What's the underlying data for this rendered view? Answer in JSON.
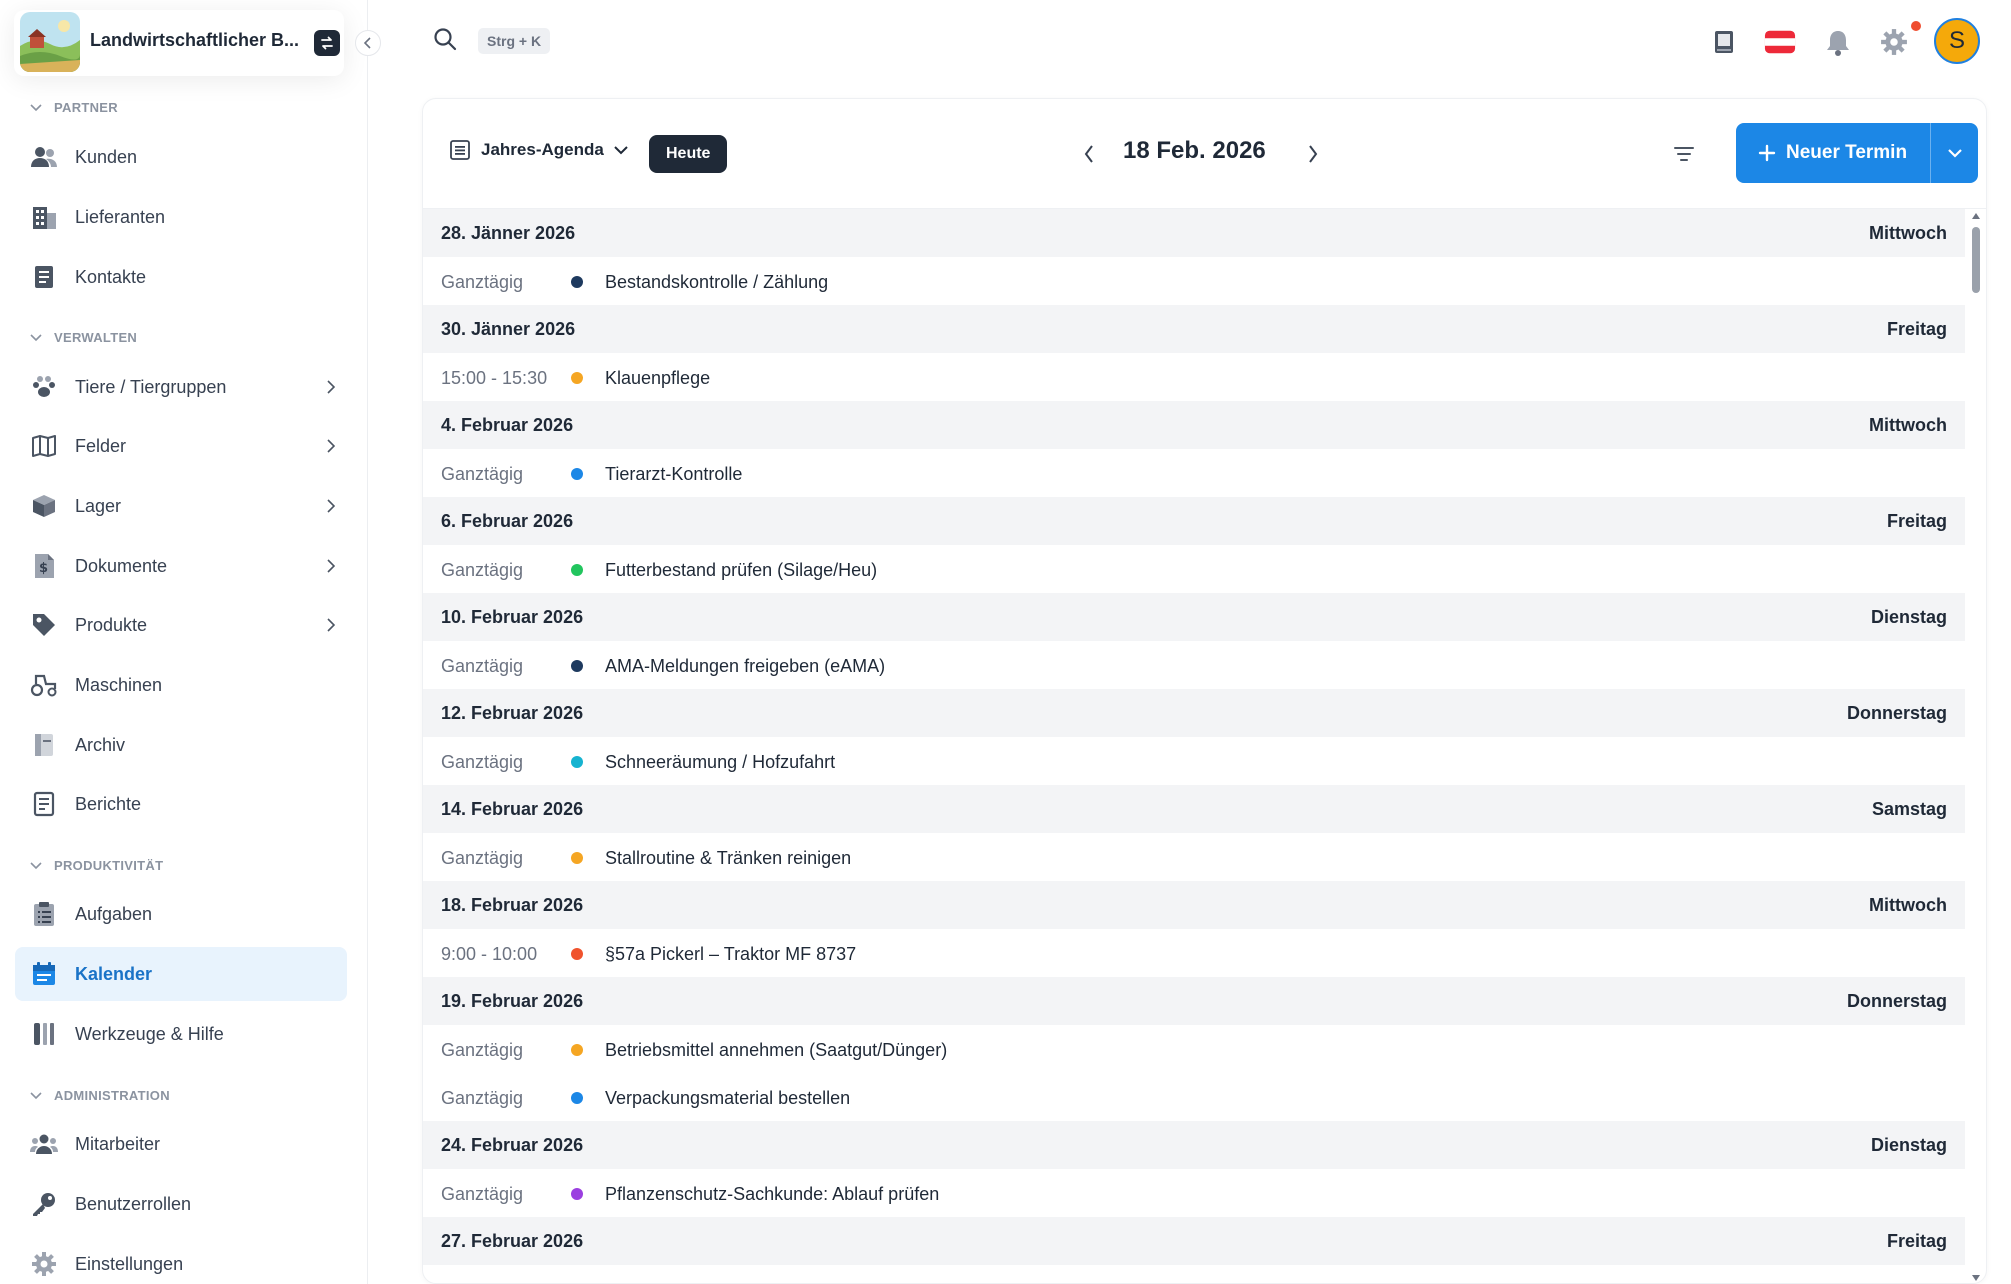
{
  "brand": {
    "name": "Landwirtschaftlicher B..."
  },
  "search": {
    "shortcut": "Strg + K"
  },
  "user": {
    "initial": "S"
  },
  "sidebar": {
    "sections": [
      {
        "title": "PARTNER"
      },
      {
        "title": "VERWALTEN"
      },
      {
        "title": "PRODUKTIVITÄT"
      },
      {
        "title": "ADMINISTRATION"
      }
    ],
    "items": [
      {
        "label": "Kunden",
        "icon": "users-icon"
      },
      {
        "label": "Lieferanten",
        "icon": "building-icon"
      },
      {
        "label": "Kontakte",
        "icon": "contact-card-icon"
      },
      {
        "label": "Tiere / Tiergruppen",
        "icon": "paw-icon"
      },
      {
        "label": "Felder",
        "icon": "map-icon"
      },
      {
        "label": "Lager",
        "icon": "box-icon"
      },
      {
        "label": "Dokumente",
        "icon": "dollar-document-icon"
      },
      {
        "label": "Produkte",
        "icon": "tag-icon"
      },
      {
        "label": "Maschinen",
        "icon": "tractor-icon"
      },
      {
        "label": "Archiv",
        "icon": "archive-icon"
      },
      {
        "label": "Berichte",
        "icon": "report-icon"
      },
      {
        "label": "Aufgaben",
        "icon": "clipboard-list-icon"
      },
      {
        "label": "Kalender",
        "icon": "calendar-icon"
      },
      {
        "label": "Werkzeuge & Hilfe",
        "icon": "tools-icon"
      },
      {
        "label": "Mitarbeiter",
        "icon": "team-icon"
      },
      {
        "label": "Benutzerrollen",
        "icon": "key-icon"
      },
      {
        "label": "Einstellungen",
        "icon": "gear-icon"
      }
    ],
    "active_item": "Kalender"
  },
  "toolbar": {
    "view_label": "Jahres-Agenda",
    "today_label": "Heute",
    "current_date": "18 Feb. 2026",
    "new_button_label": "Neuer Termin"
  },
  "colors": {
    "accent": "#1c87e6",
    "navy": "#1e3a5f",
    "orange": "#f5a623",
    "blue": "#1c87e6",
    "green": "#22c55e",
    "cyan": "#16b3d0",
    "red": "#f0532d",
    "purple": "#9b3fe0"
  },
  "agenda": [
    {
      "date": "28. Jänner 2026",
      "weekday": "Mittwoch",
      "events": [
        {
          "time": "Ganztägig",
          "title": "Bestandskontrolle / Zählung",
          "color": "#1e3a5f"
        }
      ]
    },
    {
      "date": "30. Jänner 2026",
      "weekday": "Freitag",
      "events": [
        {
          "time": "15:00 - 15:30",
          "title": "Klauenpflege",
          "color": "#f5a623"
        }
      ]
    },
    {
      "date": "4. Februar 2026",
      "weekday": "Mittwoch",
      "events": [
        {
          "time": "Ganztägig",
          "title": "Tierarzt-Kontrolle",
          "color": "#1c87e6"
        }
      ]
    },
    {
      "date": "6. Februar 2026",
      "weekday": "Freitag",
      "events": [
        {
          "time": "Ganztägig",
          "title": "Futterbestand prüfen (Silage/Heu)",
          "color": "#22c55e"
        }
      ]
    },
    {
      "date": "10. Februar 2026",
      "weekday": "Dienstag",
      "events": [
        {
          "time": "Ganztägig",
          "title": "AMA-Meldungen freigeben (eAMA)",
          "color": "#1e3a5f"
        }
      ]
    },
    {
      "date": "12. Februar 2026",
      "weekday": "Donnerstag",
      "events": [
        {
          "time": "Ganztägig",
          "title": "Schneeräumung / Hofzufahrt",
          "color": "#16b3d0"
        }
      ]
    },
    {
      "date": "14. Februar 2026",
      "weekday": "Samstag",
      "events": [
        {
          "time": "Ganztägig",
          "title": "Stallroutine & Tränken reinigen",
          "color": "#f5a623"
        }
      ]
    },
    {
      "date": "18. Februar 2026",
      "weekday": "Mittwoch",
      "events": [
        {
          "time": "9:00 - 10:00",
          "title": "§57a Pickerl – Traktor MF 8737",
          "color": "#f0532d"
        }
      ]
    },
    {
      "date": "19. Februar 2026",
      "weekday": "Donnerstag",
      "events": [
        {
          "time": "Ganztägig",
          "title": "Betriebsmittel annehmen (Saatgut/Dünger)",
          "color": "#f5a623"
        },
        {
          "time": "Ganztägig",
          "title": "Verpackungsmaterial bestellen",
          "color": "#1c87e6"
        }
      ]
    },
    {
      "date": "24. Februar 2026",
      "weekday": "Dienstag",
      "events": [
        {
          "time": "Ganztägig",
          "title": "Pflanzenschutz-Sachkunde: Ablauf prüfen",
          "color": "#9b3fe0"
        }
      ]
    },
    {
      "date": "27. Februar 2026",
      "weekday": "Freitag",
      "events": []
    }
  ]
}
